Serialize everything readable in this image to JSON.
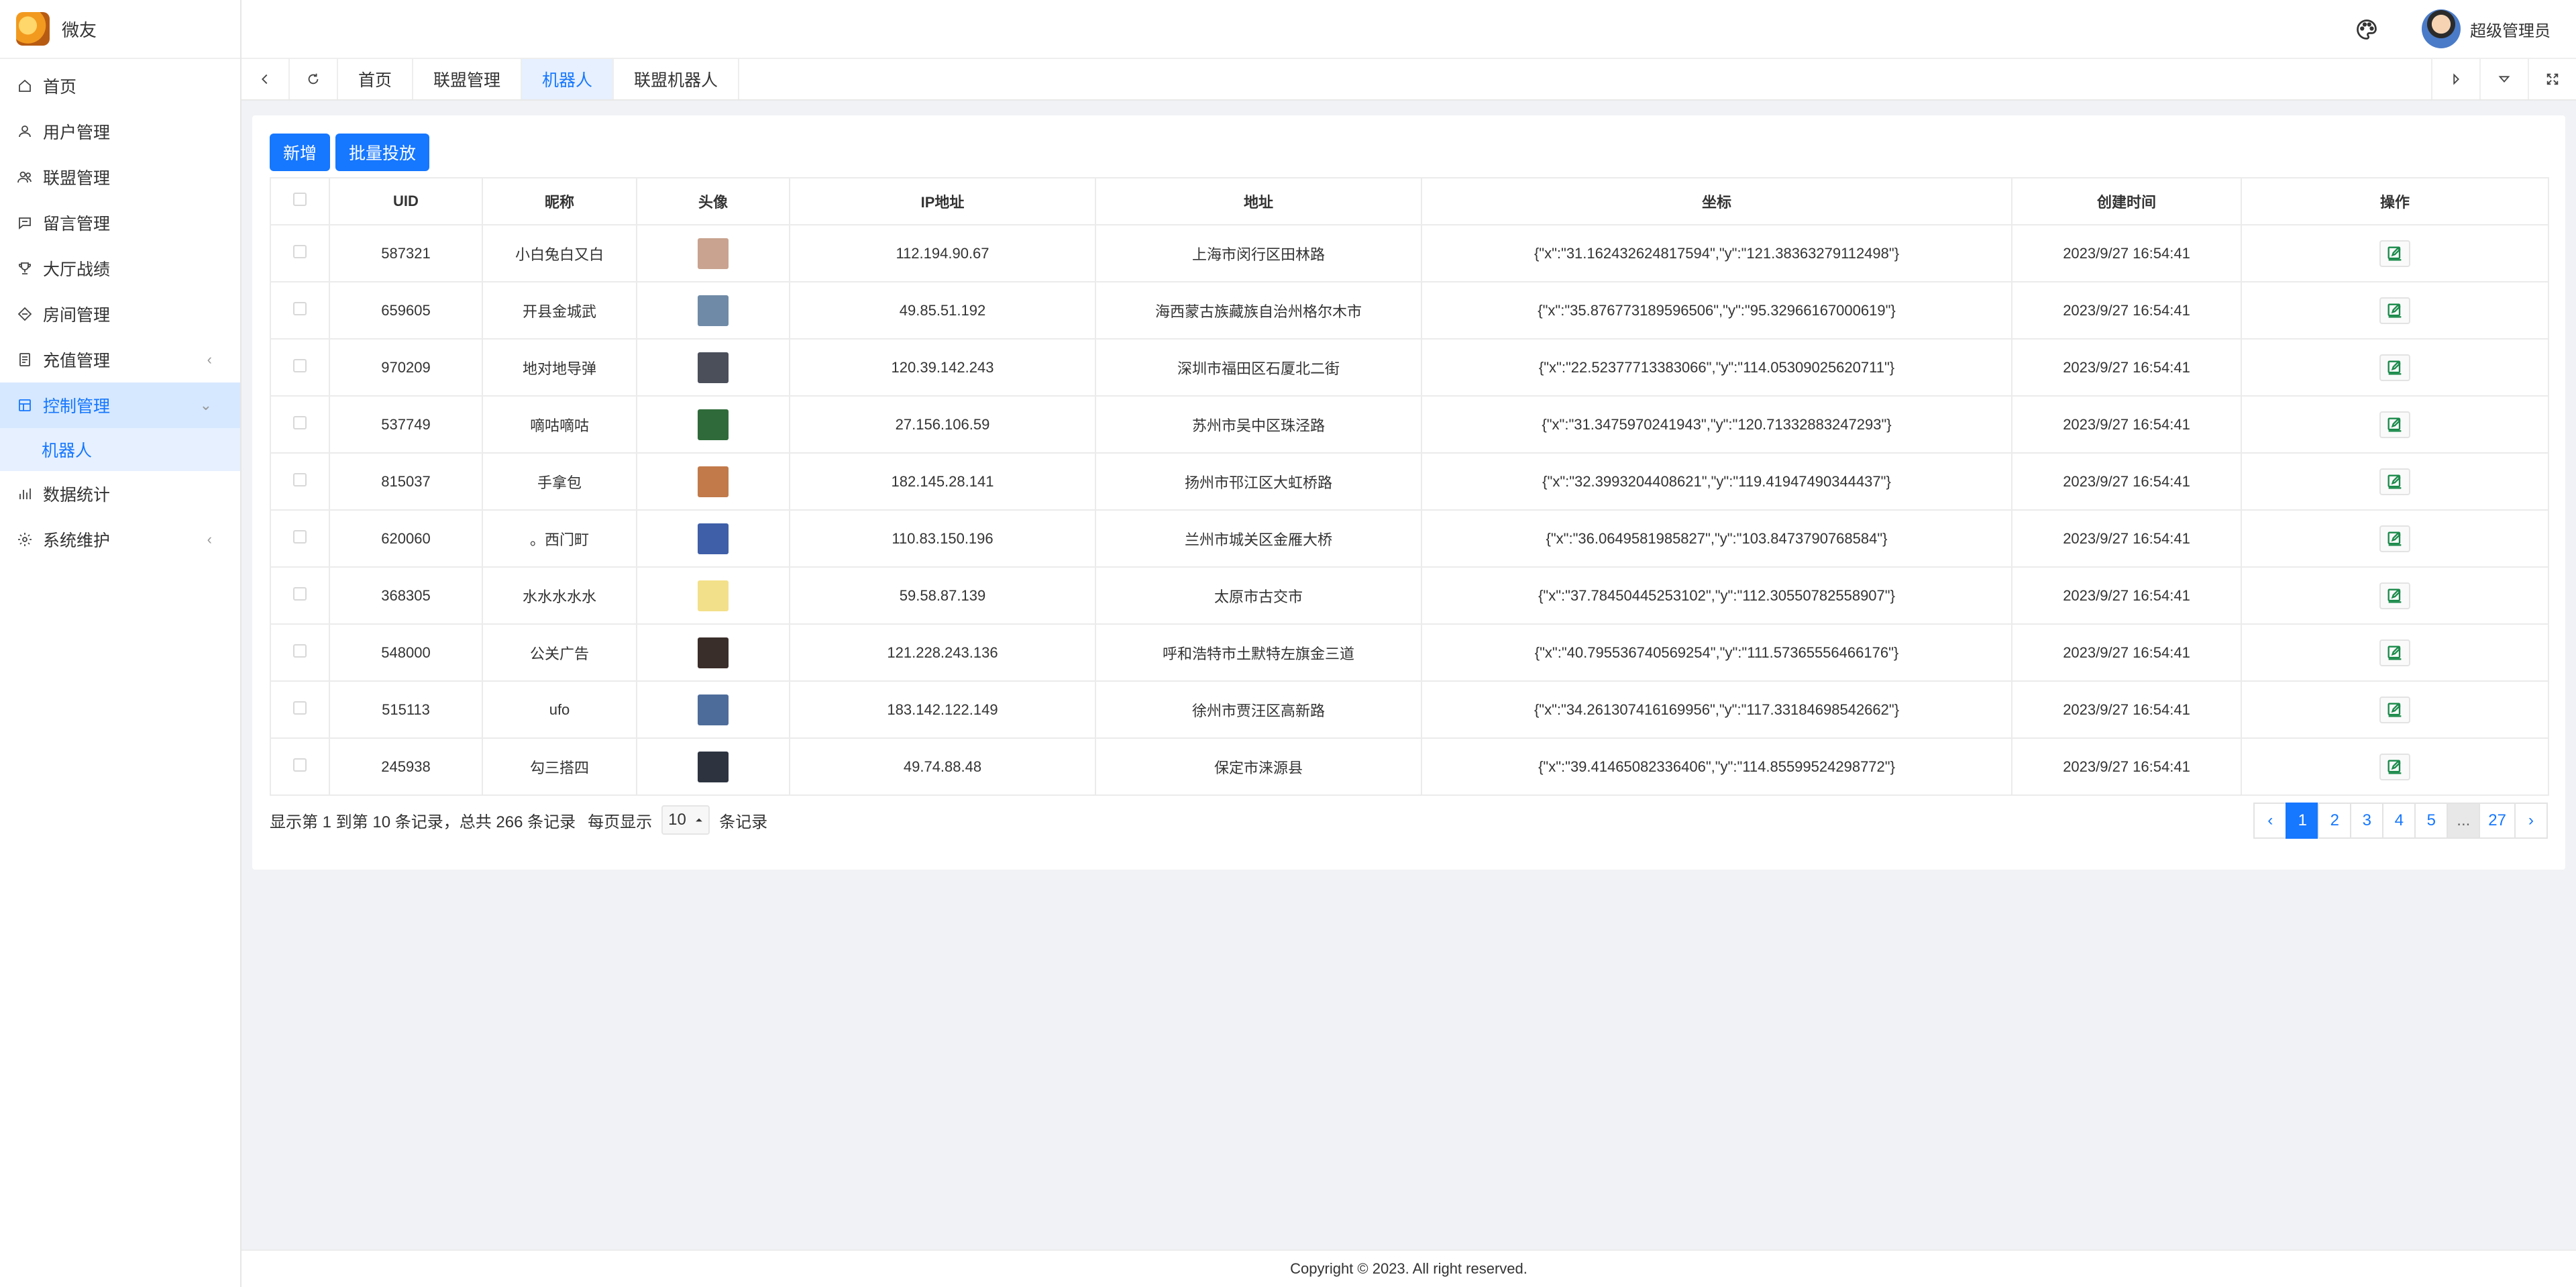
{
  "app": {
    "name": "微友"
  },
  "header": {
    "user_name": "超级管理员"
  },
  "sidebar": {
    "items": [
      {
        "label": "首页",
        "icon": "home-icon"
      },
      {
        "label": "用户管理",
        "icon": "user-icon"
      },
      {
        "label": "联盟管理",
        "icon": "users-icon"
      },
      {
        "label": "留言管理",
        "icon": "message-icon"
      },
      {
        "label": "大厅战绩",
        "icon": "trophy-icon"
      },
      {
        "label": "房间管理",
        "icon": "diamond-icon"
      },
      {
        "label": "充值管理",
        "icon": "ledger-icon",
        "chevron": "‹"
      },
      {
        "label": "控制管理",
        "icon": "control-icon",
        "chevron": "⌄"
      },
      {
        "label": "数据统计",
        "icon": "chart-icon"
      },
      {
        "label": "系统维护",
        "icon": "gear-icon",
        "chevron": "‹"
      }
    ],
    "sub_item": "机器人"
  },
  "tabs": [
    "首页",
    "联盟管理",
    "机器人",
    "联盟机器人"
  ],
  "toolbar": {
    "add": "新增",
    "batch": "批量投放"
  },
  "table": {
    "headers": [
      "UID",
      "昵称",
      "头像",
      "IP地址",
      "地址",
      "坐标",
      "创建时间",
      "操作"
    ],
    "rows": [
      {
        "uid": "587321",
        "nick": "小白兔白又白",
        "ip": "112.194.90.67",
        "addr": "上海市闵行区田林路",
        "coord": "{\"x\":\"31.162432624817594\",\"y\":\"121.38363279112498\"}",
        "time": "2023/9/27 16:54:41",
        "color": "#c9a38f"
      },
      {
        "uid": "659605",
        "nick": "开县金城武",
        "ip": "49.85.51.192",
        "addr": "海西蒙古族藏族自治州格尔木市",
        "coord": "{\"x\":\"35.876773189596506\",\"y\":\"95.32966167000619\"}",
        "time": "2023/9/27 16:54:41",
        "color": "#6f8aa6"
      },
      {
        "uid": "970209",
        "nick": "地对地导弹",
        "ip": "120.39.142.243",
        "addr": "深圳市福田区石厦北二街",
        "coord": "{\"x\":\"22.52377713383066\",\"y\":\"114.05309025620711\"}",
        "time": "2023/9/27 16:54:41",
        "color": "#4a4f5a"
      },
      {
        "uid": "537749",
        "nick": "嘀咕嘀咕",
        "ip": "27.156.106.59",
        "addr": "苏州市吴中区珠泾路",
        "coord": "{\"x\":\"31.3475970241943\",\"y\":\"120.71332883247293\"}",
        "time": "2023/9/27 16:54:41",
        "color": "#2f6b3a"
      },
      {
        "uid": "815037",
        "nick": "手拿包",
        "ip": "182.145.28.141",
        "addr": "扬州市邗江区大虹桥路",
        "coord": "{\"x\":\"32.3993204408621\",\"y\":\"119.41947490344437\"}",
        "time": "2023/9/27 16:54:41",
        "color": "#c27a4a"
      },
      {
        "uid": "620060",
        "nick": "。西门町",
        "ip": "110.83.150.196",
        "addr": "兰州市城关区金雁大桥",
        "coord": "{\"x\":\"36.0649581985827\",\"y\":\"103.8473790768584\"}",
        "time": "2023/9/27 16:54:41",
        "color": "#3f5fa8"
      },
      {
        "uid": "368305",
        "nick": "水水水水水",
        "ip": "59.58.87.139",
        "addr": "太原市古交市",
        "coord": "{\"x\":\"37.78450445253102\",\"y\":\"112.30550782558907\"}",
        "time": "2023/9/27 16:54:41",
        "color": "#f3e08a"
      },
      {
        "uid": "548000",
        "nick": "公关广告",
        "ip": "121.228.243.136",
        "addr": "呼和浩特市土默特左旗金三道",
        "coord": "{\"x\":\"40.795536740569254\",\"y\":\"111.57365556466176\"}",
        "time": "2023/9/27 16:54:41",
        "color": "#3a2e2a"
      },
      {
        "uid": "515113",
        "nick": "ufo",
        "ip": "183.142.122.149",
        "addr": "徐州市贾汪区高新路",
        "coord": "{\"x\":\"34.261307416169956\",\"y\":\"117.33184698542662\"}",
        "time": "2023/9/27 16:54:41",
        "color": "#4d6c9a"
      },
      {
        "uid": "245938",
        "nick": "勾三搭四",
        "ip": "49.74.88.48",
        "addr": "保定市涞源县",
        "coord": "{\"x\":\"39.41465082336406\",\"y\":\"114.85599524298772\"}",
        "time": "2023/9/27 16:54:41",
        "color": "#2d3440"
      }
    ]
  },
  "footer": {
    "summary": "显示第 1 到第 10 条记录，总共 266 条记录",
    "per_page_prefix": "每页显示",
    "per_page_value": "10",
    "per_page_suffix": "条记录"
  },
  "pager": {
    "prev": "‹",
    "pages": [
      "1",
      "2",
      "3",
      "4",
      "5"
    ],
    "ellipsis": "...",
    "last": "27",
    "next": "›",
    "current": "1"
  },
  "copyright": "Copyright © 2023. All right reserved.",
  "colors": {
    "accent": "#1677ff",
    "active_bg": "#d6e8ff",
    "sub_bg": "#e6f0ff",
    "edit_green": "#1a8a4a"
  }
}
